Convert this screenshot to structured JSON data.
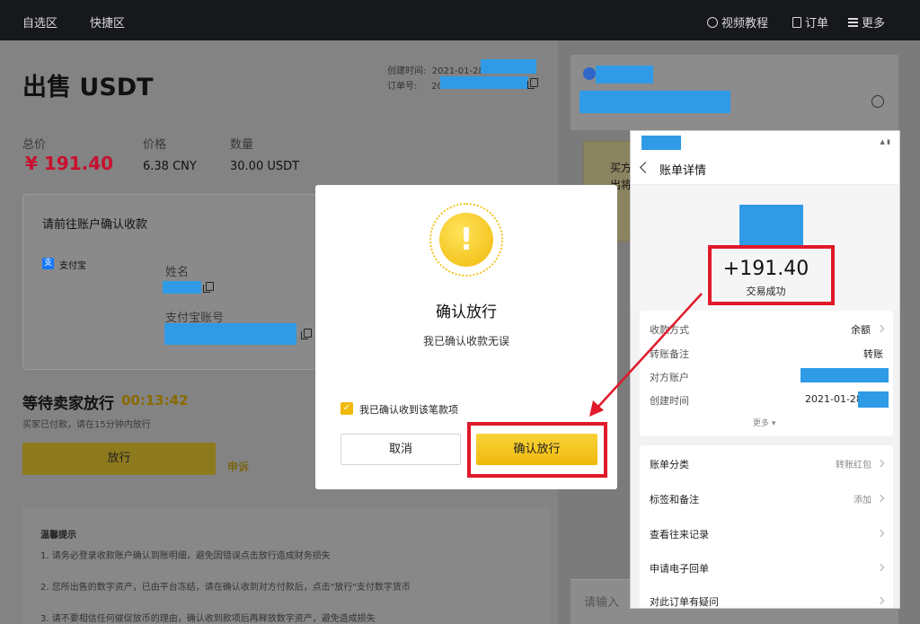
{
  "topnav": {
    "watchlist": "自选区",
    "quick": "快捷区",
    "video": "视频教程",
    "orders": "订单",
    "more": "更多"
  },
  "order": {
    "title": "出售 USDT",
    "created_label": "创建时间:",
    "created_value": "2021-01-28",
    "order_no_label": "订单号:",
    "order_no_value": "201",
    "total_label": "总价",
    "total_value": "¥ 191.40",
    "price_label": "价格",
    "price_value": "6.38 CNY",
    "qty_label": "数量",
    "qty_value": "30.00 USDT"
  },
  "payment": {
    "heading": "请前往账户确认收款",
    "method": "支付宝",
    "method_icon": "支",
    "name_label": "姓名",
    "account_label": "支付宝账号"
  },
  "status": {
    "title": "等待卖家放行",
    "timer": "00:13:42",
    "hint": "买家已付款，请在15分钟内放行",
    "release_button": "放行",
    "appeal": "申诉"
  },
  "tips": {
    "heading": "温馨提示",
    "items": [
      "1. 请务必登录收款账户确认到账明细，避免因错误点击放行造成财务损失",
      "2. 您所出售的数字资产，已由平台冻结，请在确认收到对方付款后，点击\"放行\"支付数字货币",
      "3. 请不要相信任何催促放币的理由，确认收到款项后再释放数字资产，避免造成损失"
    ]
  },
  "right_panel": {
    "notice_text": "买方",
    "notice_text2": "出将",
    "input_placeholder": "请输入"
  },
  "modal": {
    "title": "确认放行",
    "subtitle": "我已确认收款无误",
    "checkbox_label": "我已确认收到该笔款项",
    "cancel": "取消",
    "confirm": "确认放行"
  },
  "phone": {
    "header": "账单详情",
    "amount": "+191.40",
    "amount_status": "交易成功",
    "rows": [
      {
        "label": "收款方式",
        "value": "余额"
      },
      {
        "label": "转账备注",
        "value": "转账"
      },
      {
        "label": "对方账户",
        "value": ""
      },
      {
        "label": "创建时间",
        "value": "2021-01-28"
      }
    ],
    "more": "更多",
    "menu": [
      {
        "label": "账单分类",
        "value": "转账红包"
      },
      {
        "label": "标签和备注",
        "value": "添加"
      },
      {
        "label": "查看往来记录",
        "value": ""
      },
      {
        "label": "申请电子回单",
        "value": ""
      },
      {
        "label": "对此订单有疑问",
        "value": ""
      }
    ]
  },
  "colors": {
    "accent": "#f0b90b",
    "highlight": "#e0192b",
    "price_red": "#c8102e",
    "redaction": "#2f9be6"
  }
}
